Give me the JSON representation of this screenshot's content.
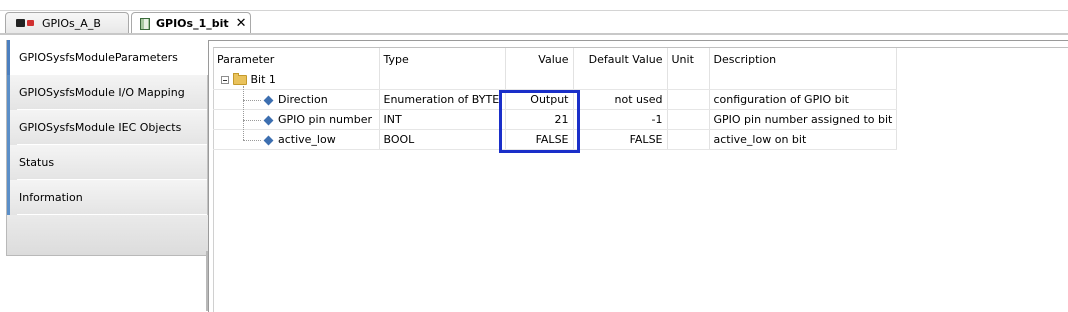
{
  "tabs": [
    {
      "label": "GPIOs_A_B",
      "icon": "device-icon",
      "active": false
    },
    {
      "label": "GPIOs_1_bit",
      "icon": "module-icon",
      "active": true,
      "close_glyph": "✕"
    }
  ],
  "nav": {
    "items": [
      {
        "label": "GPIOSysfsModuleParameters",
        "active": true
      },
      {
        "label": "GPIOSysfsModule I/O Mapping",
        "active": false
      },
      {
        "label": "GPIOSysfsModule IEC Objects",
        "active": false
      },
      {
        "label": "Status",
        "active": false
      },
      {
        "label": "Information",
        "active": false
      }
    ]
  },
  "table": {
    "columns": [
      "Parameter",
      "Type",
      "Value",
      "Default Value",
      "Unit",
      "Description"
    ],
    "group": "Bit 1",
    "rows": [
      {
        "parameter": "Direction",
        "type": "Enumeration of BYTE",
        "value": "Output",
        "default": "not used",
        "unit": "",
        "description": "configuration of GPIO bit"
      },
      {
        "parameter": "GPIO pin number",
        "type": "INT",
        "value": "21",
        "default": "-1",
        "unit": "",
        "description": "GPIO pin number assigned to bit"
      },
      {
        "parameter": "active_low",
        "type": "BOOL",
        "value": "FALSE",
        "default": "FALSE",
        "unit": "",
        "description": "active_low on bit"
      }
    ]
  },
  "colors": {
    "highlight": "#1a2fc9",
    "nav_accent": "#5b8fc8"
  }
}
